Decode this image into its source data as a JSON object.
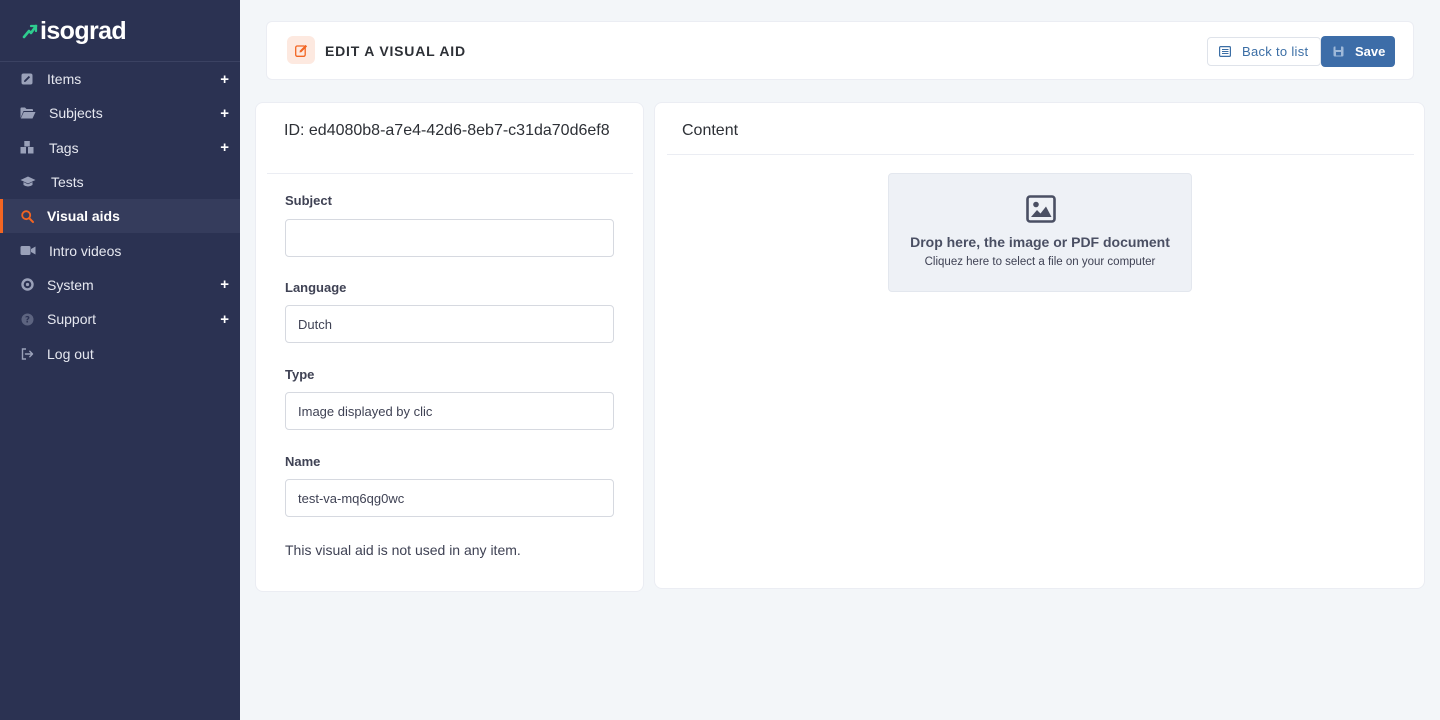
{
  "brand": {
    "name": "isograd"
  },
  "sidebar": {
    "items": [
      {
        "label": "Items",
        "icon": "pencil-square-icon",
        "expandable": true,
        "active": false
      },
      {
        "label": "Subjects",
        "icon": "folder-open-icon",
        "expandable": true,
        "active": false
      },
      {
        "label": "Tags",
        "icon": "tags-icon",
        "expandable": true,
        "active": false
      },
      {
        "label": "Tests",
        "icon": "graduation-cap-icon",
        "expandable": false,
        "active": false
      },
      {
        "label": "Visual aids",
        "icon": "search-icon",
        "expandable": false,
        "active": true
      },
      {
        "label": "Intro videos",
        "icon": "video-camera-icon",
        "expandable": false,
        "active": false
      },
      {
        "label": "System",
        "icon": "gear-icon",
        "expandable": true,
        "active": false
      },
      {
        "label": "Support",
        "icon": "question-circle-icon",
        "expandable": true,
        "active": false
      },
      {
        "label": "Log out",
        "icon": "sign-out-icon",
        "expandable": false,
        "active": false
      }
    ],
    "expand_symbol": "+"
  },
  "header": {
    "title": "EDIT A VISUAL AID",
    "back_label": "Back to list",
    "save_label": "Save"
  },
  "form": {
    "id_text": "ID: ed4080b8-a7e4-42d6-8eb7-c31da70d6ef8",
    "subject_label": "Subject",
    "subject_value": "",
    "language_label": "Language",
    "language_value": "Dutch",
    "type_label": "Type",
    "type_value": "Image displayed by clic",
    "name_label": "Name",
    "name_value": "test-va-mq6qg0wc",
    "usage_text": "This visual aid is not used in any item."
  },
  "content": {
    "title": "Content",
    "drop_main": "Drop here, the image or PDF document",
    "drop_sub": "Cliquez here to select a file on your computer"
  },
  "colors": {
    "sidebar_bg": "#2b3252",
    "accent": "#f26522",
    "primary": "#3d6da8",
    "page_bg": "#f3f6f9"
  }
}
